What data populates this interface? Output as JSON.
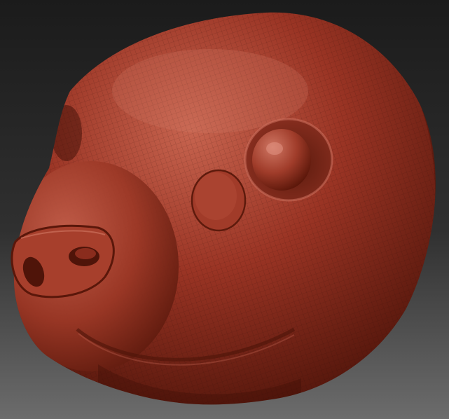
{
  "scene": {
    "background_top": "#1b1b1b",
    "background_bottom": "#6c6c6c",
    "clay_base": "#9a3424",
    "clay_highlight": "#c7644f",
    "clay_shadow": "#4a1208",
    "wireframe": "#2b0b05",
    "icons": [
      "sculpted-head-icon"
    ]
  }
}
